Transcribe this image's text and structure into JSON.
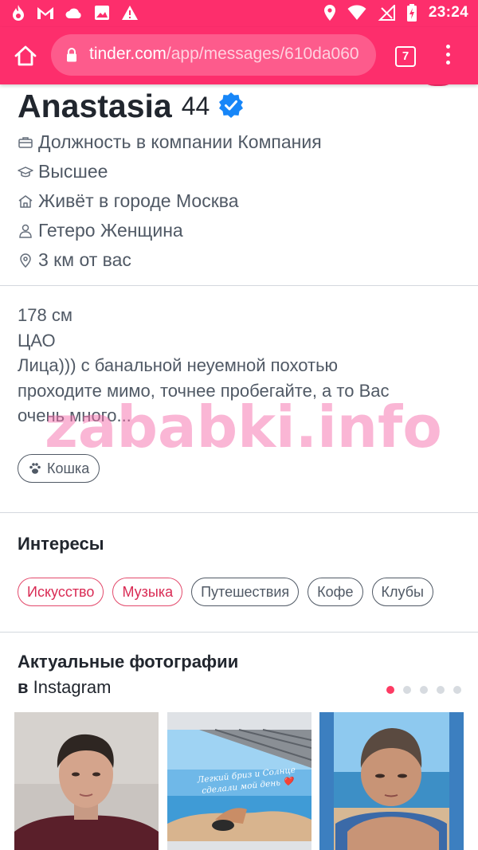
{
  "status_bar": {
    "time": "23:24",
    "icons": [
      "fire-icon",
      "gmail-icon",
      "cloud-icon",
      "image-icon",
      "warning-icon",
      "location-icon",
      "wifi-icon",
      "no-signal-icon",
      "battery-charging-icon"
    ]
  },
  "browser": {
    "url_host": "tinder.com",
    "url_path": "/app/messages/610da060",
    "tab_count": "7",
    "accent_color": "#fd2e6c"
  },
  "profile": {
    "name": "Anastasia",
    "age": "44",
    "verified": true,
    "info": [
      {
        "icon": "briefcase-icon",
        "text": "Должность в компании Компания"
      },
      {
        "icon": "graduation-cap-icon",
        "text": "Высшее"
      },
      {
        "icon": "home-icon",
        "text": "Живёт в городе Москва"
      },
      {
        "icon": "person-icon",
        "text": "Гетеро Женщина"
      },
      {
        "icon": "location-pin-icon",
        "text": "3 км от вас"
      }
    ],
    "bio_lines": [
      "178 см",
      "ЦАО",
      "Лица))) с банальной неуемной похотью",
      "проходите мимо, точнее пробегайте, а то Вас",
      "очень много..."
    ],
    "pet": "Кошка"
  },
  "watermark": "zababki.info",
  "interests": {
    "title": "Интересы",
    "items": [
      {
        "label": "Искусство",
        "shared": true
      },
      {
        "label": "Музыка",
        "shared": true
      },
      {
        "label": "Путешествия",
        "shared": false
      },
      {
        "label": "Кофе",
        "shared": false
      },
      {
        "label": "Клубы",
        "shared": false
      }
    ]
  },
  "instagram": {
    "title": "Актуальные фотографии",
    "subtitle_prefix": "в",
    "subtitle_name": "Instagram",
    "page_index": 1,
    "page_count": 5,
    "photo_caption_line1": "Легкий бриз и Солнце",
    "photo_caption_line2": "сделали мой день ❤️"
  }
}
